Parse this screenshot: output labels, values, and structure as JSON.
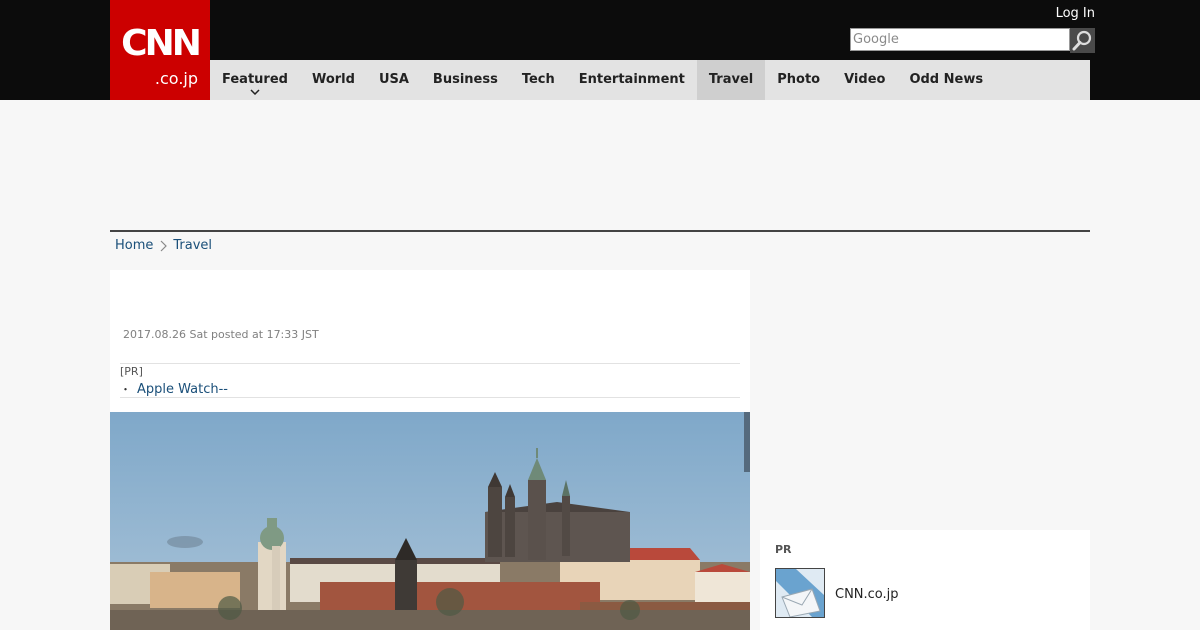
{
  "header": {
    "logo_main": "CNN",
    "logo_sub": ".co.jp",
    "login_label": "Log In",
    "search_placeholder": "Google"
  },
  "nav": {
    "items": [
      {
        "label": "Featured"
      },
      {
        "label": "World"
      },
      {
        "label": "USA"
      },
      {
        "label": "Business"
      },
      {
        "label": "Tech"
      },
      {
        "label": "Entertainment"
      },
      {
        "label": "Travel"
      },
      {
        "label": "Photo"
      },
      {
        "label": "Video"
      },
      {
        "label": "Odd News"
      }
    ],
    "active": "Travel"
  },
  "breadcrumb": {
    "home": "Home",
    "current": "Travel"
  },
  "article": {
    "timestamp": "2017.08.26 Sat posted at 17:33 JST",
    "pr_tag": "[PR]",
    "pr_link": "Apple Watch--",
    "pr_bullet": "・"
  },
  "sidebar": {
    "pr_label": "PR",
    "pr_item": "CNN.co.jp"
  },
  "colors": {
    "brand_red": "#cc0000",
    "topbar": "#0c0c0c",
    "nav_bg": "#e3e3e3",
    "link_blue": "#1a4f79",
    "sky": "#7ea6c8"
  },
  "icons": {
    "search": "magnifier-icon",
    "dropdown": "chevron-down-icon",
    "breadcrumb_sep": "chevron-right-icon"
  }
}
